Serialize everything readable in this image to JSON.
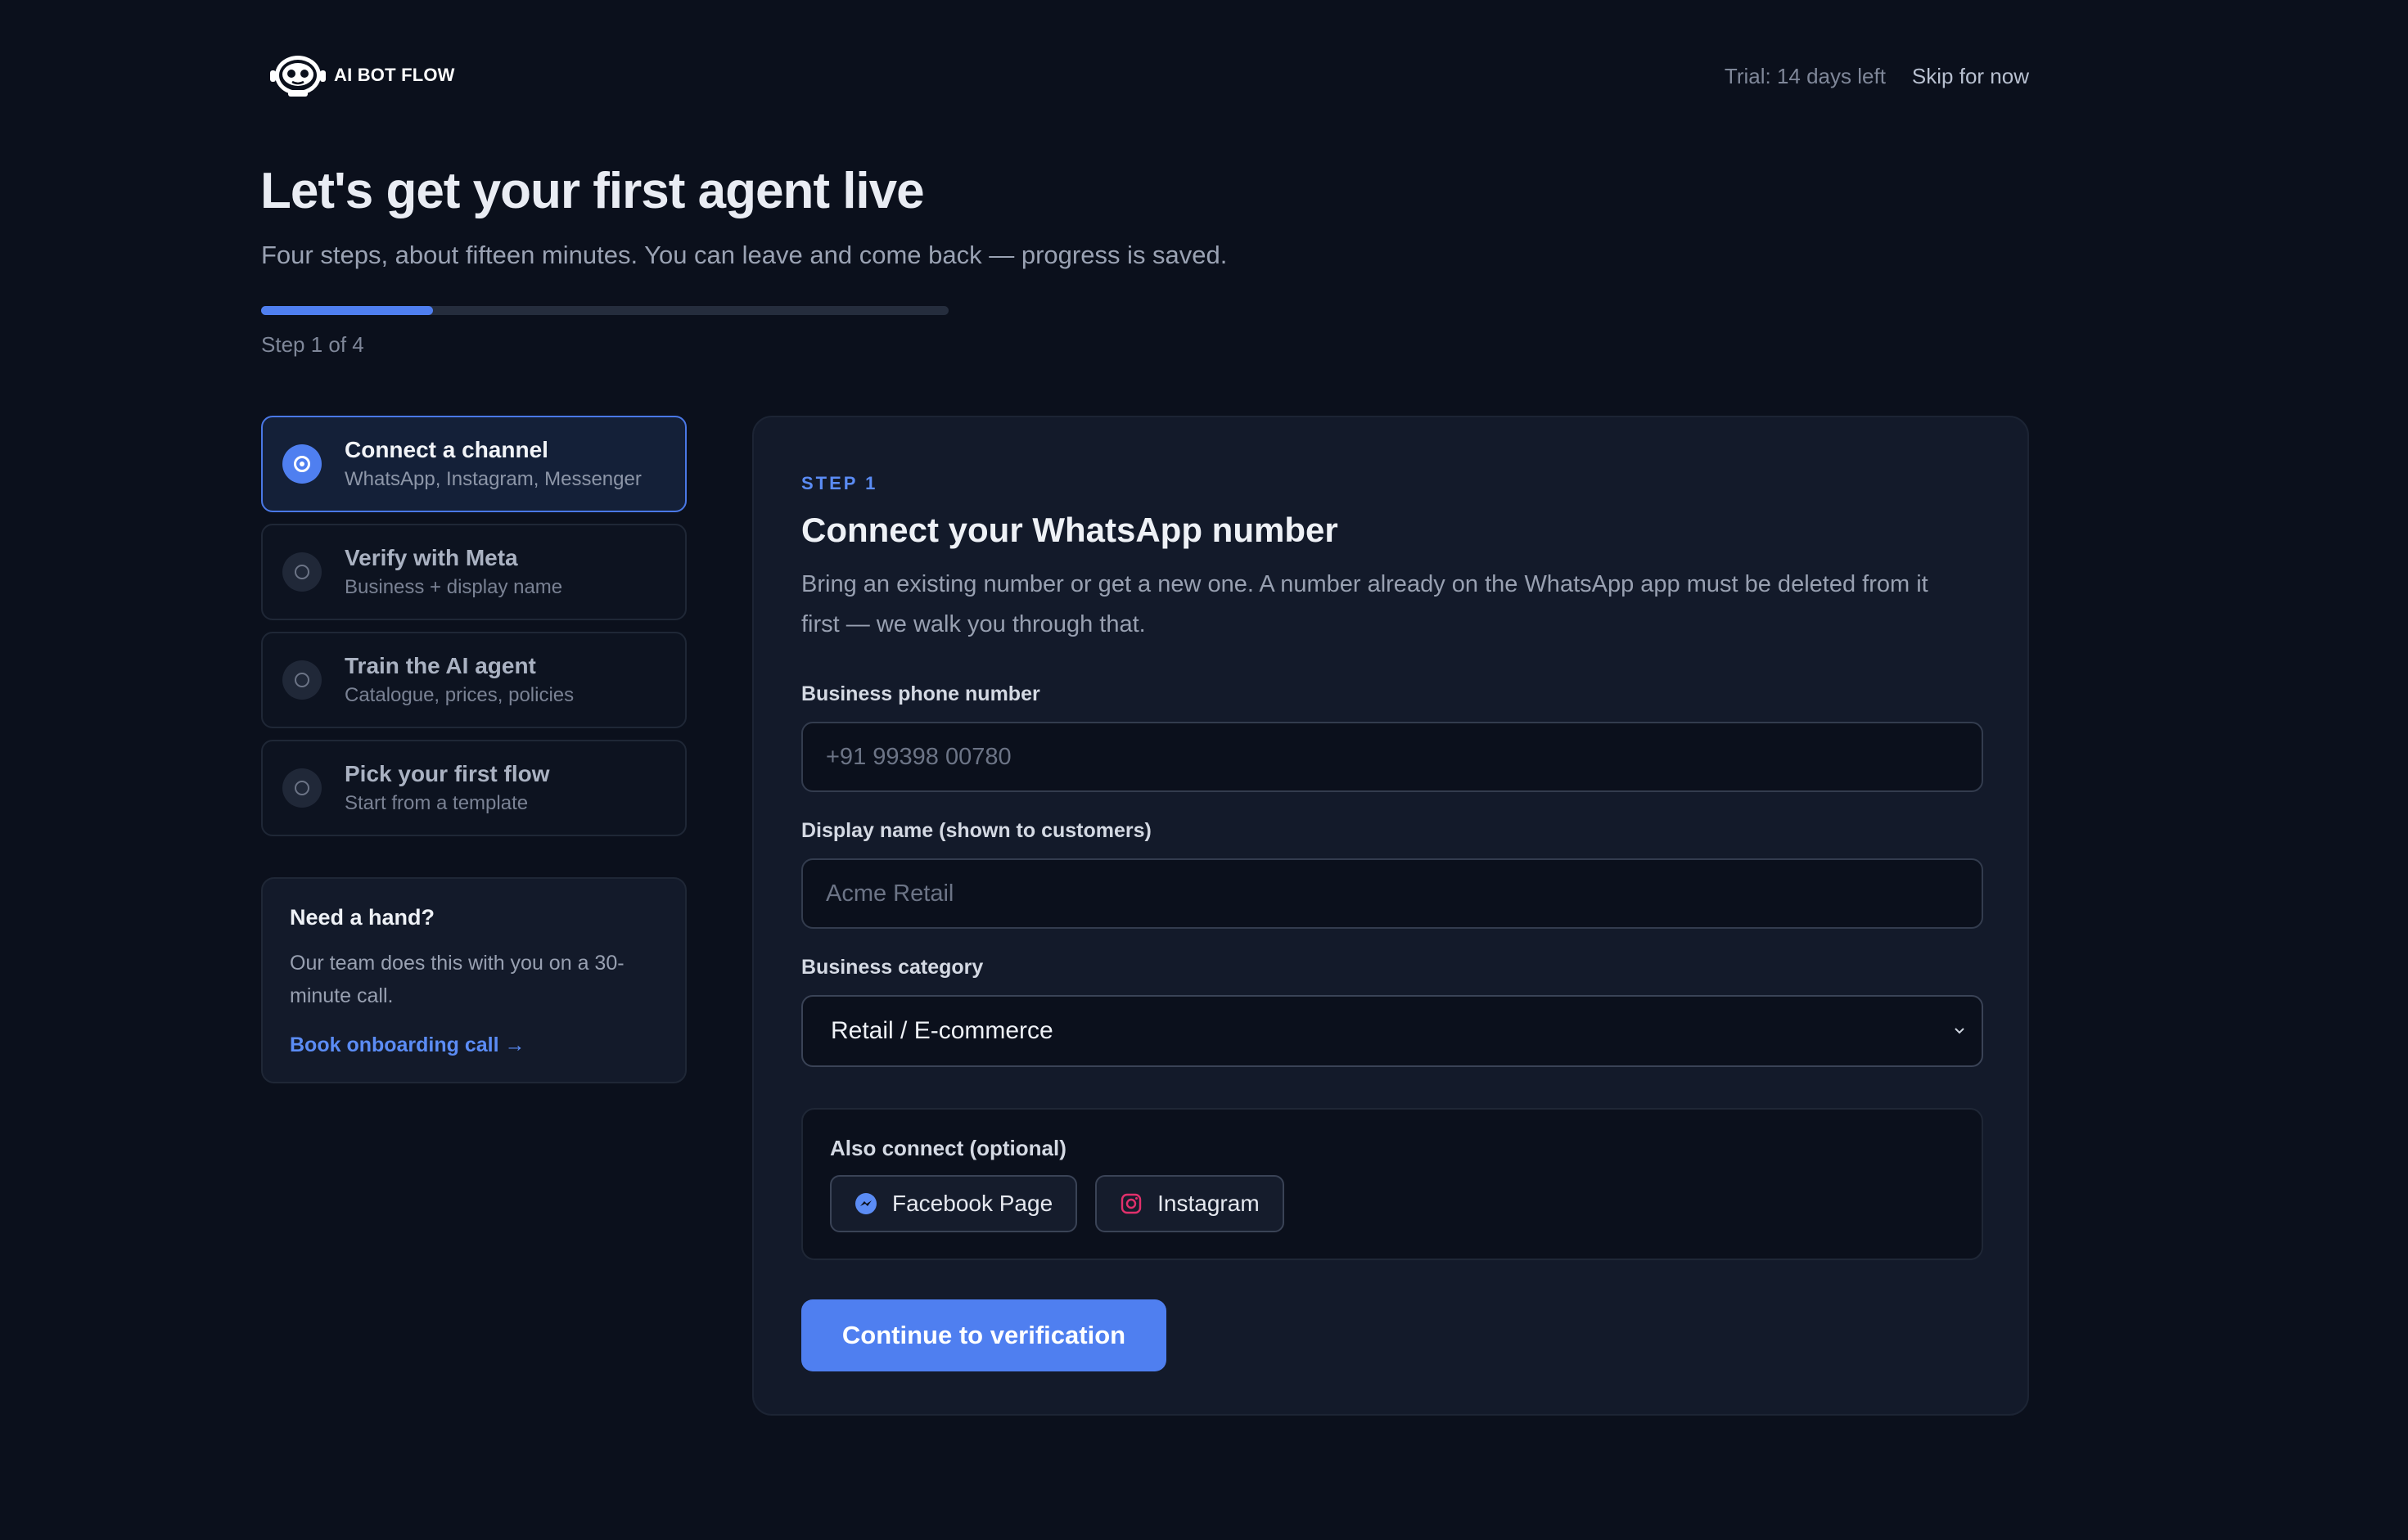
{
  "brand": {
    "name": "AI BOT FLOW"
  },
  "header": {
    "trial": "Trial: 14 days left",
    "skip": "Skip for now"
  },
  "hero": {
    "title": "Let's get your first agent live",
    "subtitle": "Four steps, about fifteen minutes. You can leave and come back — progress is saved.",
    "progress_fraction": 0.25,
    "step_count": "Step 1 of 4"
  },
  "steps": [
    {
      "title": "Connect a channel",
      "subtitle": "WhatsApp, Instagram, Messenger",
      "active": true
    },
    {
      "title": "Verify with Meta",
      "subtitle": "Business + display name",
      "active": false
    },
    {
      "title": "Train the AI agent",
      "subtitle": "Catalogue, prices, policies",
      "active": false
    },
    {
      "title": "Pick your first flow",
      "subtitle": "Start from a template",
      "active": false
    }
  ],
  "help": {
    "title": "Need a hand?",
    "body": "Our team does this with you on a 30-minute call.",
    "link": "Book onboarding call →"
  },
  "form": {
    "eyebrow": "STEP 1",
    "title": "Connect your WhatsApp number",
    "description": "Bring an existing number or get a new one. A number already on the WhatsApp app must be deleted from it first — we walk you through that.",
    "phone": {
      "label": "Business phone number",
      "placeholder": "+91 99398 00780",
      "value": ""
    },
    "display_name": {
      "label": "Display name (shown to customers)",
      "placeholder": "Acme Retail",
      "value": ""
    },
    "category": {
      "label": "Business category",
      "value": "Retail / E-commerce"
    },
    "optional": {
      "title": "Also connect (optional)",
      "facebook": "Facebook Page",
      "instagram": "Instagram"
    },
    "cta": "Continue to verification"
  },
  "colors": {
    "background": "#0b101c",
    "card": "#131a2a",
    "accent": "#4f7ff0",
    "link": "#5b8cf5",
    "instagram": "#e1306c"
  }
}
